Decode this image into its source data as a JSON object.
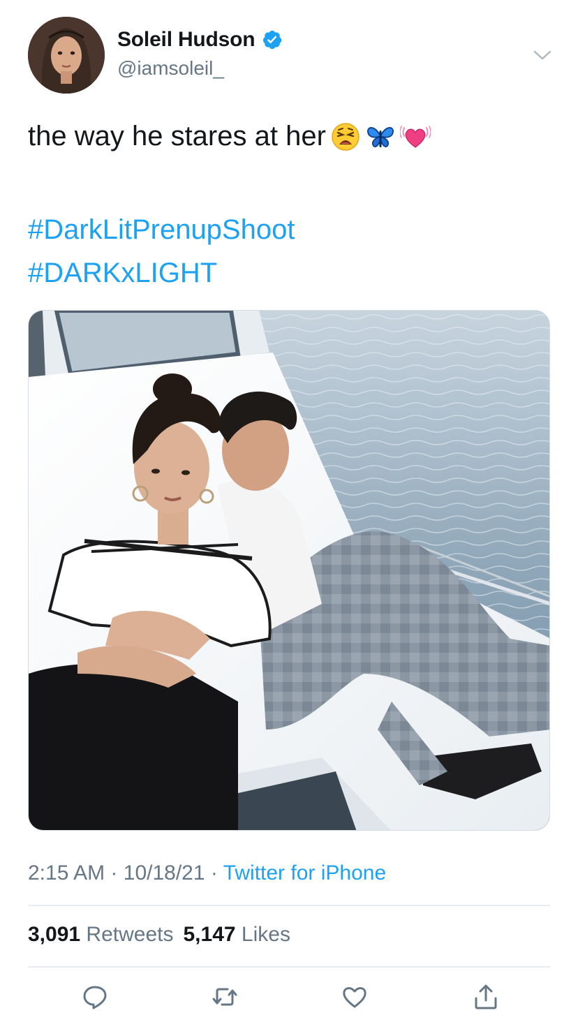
{
  "author": {
    "display_name": "Soleil Hudson",
    "handle": "@iamsoleil_",
    "verified": true,
    "avatar_icon": "profile-photo"
  },
  "tweet": {
    "text": "the way he stares at her",
    "emojis": [
      "weary-face-emoji",
      "blue-butterfly-emoji",
      "beating-heart-emoji"
    ],
    "hashtags": [
      "#DarkLitPrenupShoot",
      "#DARKxLIGHT"
    ],
    "media_icon": "photo-couple-on-boat"
  },
  "meta": {
    "time": "2:15 AM",
    "separator": "·",
    "date": "10/18/21",
    "source": "Twitter for iPhone"
  },
  "stats": {
    "retweets_count": "3,091",
    "retweets_label": "Retweets",
    "likes_count": "5,147",
    "likes_label": "Likes"
  },
  "actions": [
    "reply-icon",
    "retweet-icon",
    "like-icon",
    "share-icon"
  ],
  "colors": {
    "accent": "#1da1f2",
    "secondary_text": "#657786",
    "primary_text": "#14171a",
    "divider": "#e6ecf0"
  }
}
